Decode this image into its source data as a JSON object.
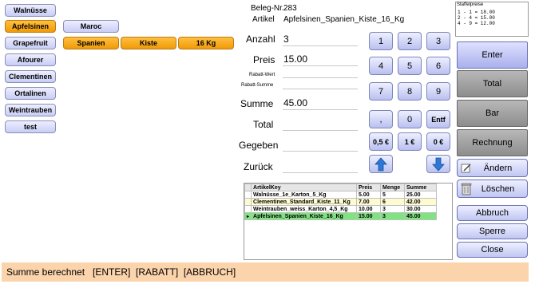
{
  "categories": {
    "items": [
      {
        "label": "Walnüsse",
        "active": false
      },
      {
        "label": "Apfelsinen",
        "active": true
      },
      {
        "label": "Grapefruit",
        "active": false
      },
      {
        "label": "Afourer",
        "active": false
      },
      {
        "label": "Clementinen",
        "active": false
      },
      {
        "label": "Ortalinen",
        "active": false
      },
      {
        "label": "Weintrauben",
        "active": false
      },
      {
        "label": "test",
        "active": false
      }
    ]
  },
  "filters": {
    "origin": "Maroc",
    "country": "Spanien",
    "package": "Kiste",
    "weight": "16 Kg"
  },
  "form": {
    "beleg_label": "Beleg-Nr.",
    "beleg_value": "283",
    "artikel_label": "Artikel",
    "artikel_value": "Apfelsinen_Spanien_Kiste_16_Kg",
    "anzahl_label": "Anzahl",
    "anzahl_value": "3",
    "preis_label": "Preis",
    "preis_value": "15.00",
    "rabatt_wert_label": "Rabatt-Wert",
    "rabatt_summe_label": "Rabatt-Summe",
    "summe_label": "Summe",
    "summe_value": "45.00",
    "total_label": "Total",
    "gegeben_label": "Gegeben",
    "zurueck_label": "Zurück"
  },
  "keypad": {
    "row1": [
      "1",
      "2",
      "3"
    ],
    "row2": [
      "4",
      "5",
      "6"
    ],
    "row3": [
      "7",
      "8",
      "9"
    ],
    "row4": [
      ",",
      "0",
      "Entf"
    ],
    "row5": [
      "0,5 €",
      "1 €",
      "0 €"
    ]
  },
  "staffel": {
    "title": "Staffelpreise",
    "lines": "1 - 1 = 18.00\n2 - 4 = 15.00\n4 - 9 = 12.00"
  },
  "actions": {
    "enter": "Enter",
    "total": "Total",
    "bar": "Bar",
    "rechnung": "Rechnung",
    "aendern": "Ändern",
    "loeschen": "Löschen",
    "abbruch": "Abbruch",
    "sperre": "Sperre",
    "close": "Close"
  },
  "grid": {
    "headers": [
      "ArtikelKey",
      "Preis",
      "Menge",
      "Summe"
    ],
    "rows": [
      {
        "artikel": "Walnüsse_1e_Karton_5_Kg",
        "preis": "5.00",
        "menge": "5",
        "summe": "25.00",
        "color": "#ffffff"
      },
      {
        "artikel": "Clementinen_Standard_Kiste_11_Kg",
        "preis": "7.00",
        "menge": "6",
        "summe": "42.00",
        "color": "#fffbd0"
      },
      {
        "artikel": "Weintrauben_weiss_Karton_4,5_Kg",
        "preis": "10.00",
        "menge": "3",
        "summe": "30.00",
        "color": "#ffffff"
      },
      {
        "artikel": "Apfelsinen_Spanien_Kiste_16_Kg",
        "preis": "15.00",
        "menge": "3",
        "summe": "45.00",
        "color": "#7fe37f"
      }
    ]
  },
  "status_text": "Summe berechnet   [ENTER]  [RABATT]  [ABBRUCH]",
  "colors": {
    "active_button": "#f5a623",
    "status_bar": "#fcd4ac",
    "selected_row": "#7fe37f"
  }
}
